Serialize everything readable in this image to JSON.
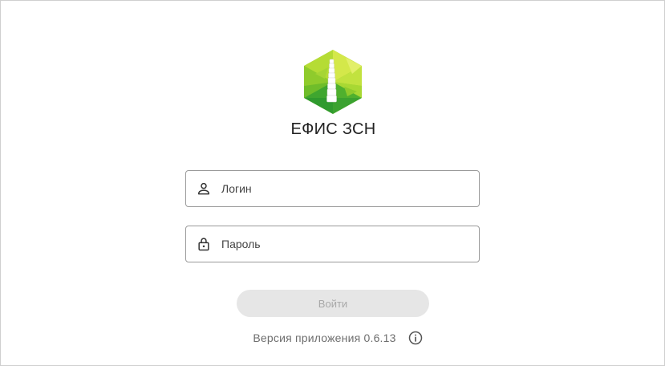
{
  "app": {
    "title": "ЕФИС ЗСН",
    "logo_icon": "efis-zsn-hexagon-logo",
    "brand_colors": [
      "#c6e03a",
      "#9ccd2a",
      "#62b52a",
      "#2f9a2e"
    ]
  },
  "login_form": {
    "login": {
      "placeholder": "Логин",
      "value": "",
      "icon": "person-icon"
    },
    "password": {
      "placeholder": "Пароль",
      "value": "",
      "icon": "lock-icon"
    },
    "submit": {
      "label": "Войти",
      "enabled": false
    }
  },
  "footer": {
    "version_text": "Версия приложения 0.6.13",
    "info_icon": "info-icon"
  }
}
